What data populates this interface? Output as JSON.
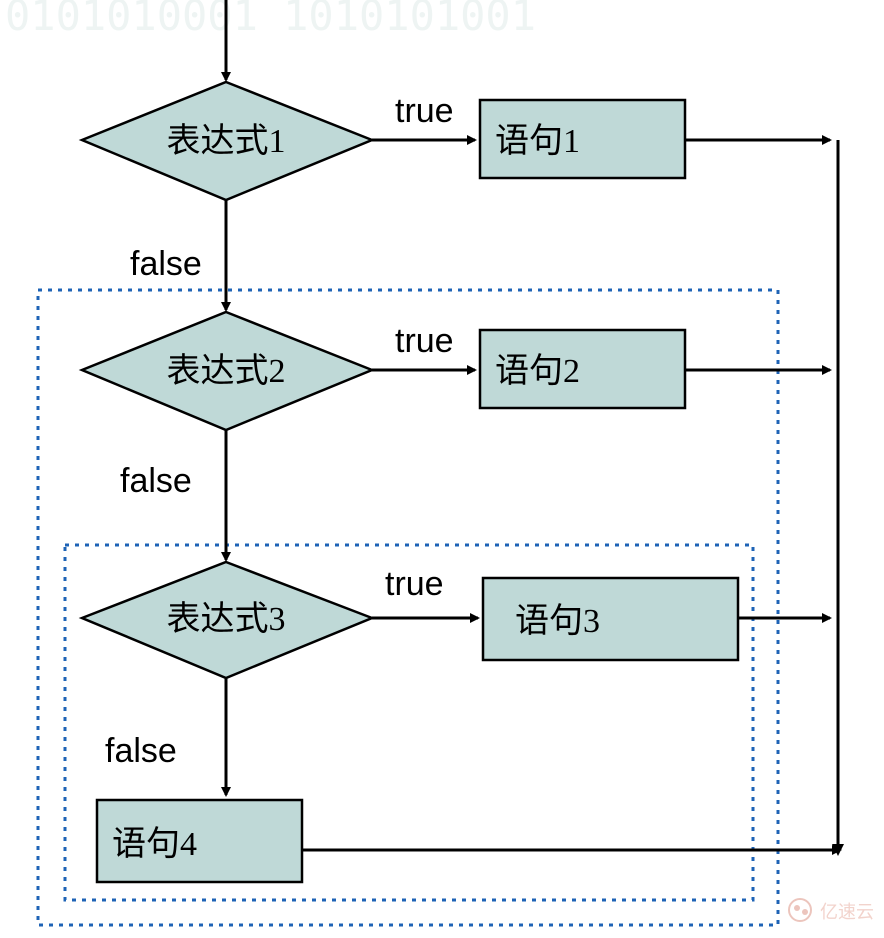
{
  "diagram": {
    "type": "flowchart",
    "nodes": {
      "decision1": {
        "label": "表达式1",
        "kind": "decision"
      },
      "decision2": {
        "label": "表达式2",
        "kind": "decision"
      },
      "decision3": {
        "label": "表达式3",
        "kind": "decision"
      },
      "stmt1": {
        "label": "语句1",
        "kind": "process"
      },
      "stmt2": {
        "label": "语句2",
        "kind": "process"
      },
      "stmt3": {
        "label": "语句3",
        "kind": "process"
      },
      "stmt4": {
        "label": "语句4",
        "kind": "process"
      }
    },
    "edges": {
      "true1": "true",
      "false1": "false",
      "true2": "true",
      "false2": "false",
      "true3": "true",
      "false3": "false"
    },
    "watermark": "亿速云",
    "colors": {
      "node_fill": "#bfd9d7",
      "dotted_border": "#1e63b6"
    }
  }
}
